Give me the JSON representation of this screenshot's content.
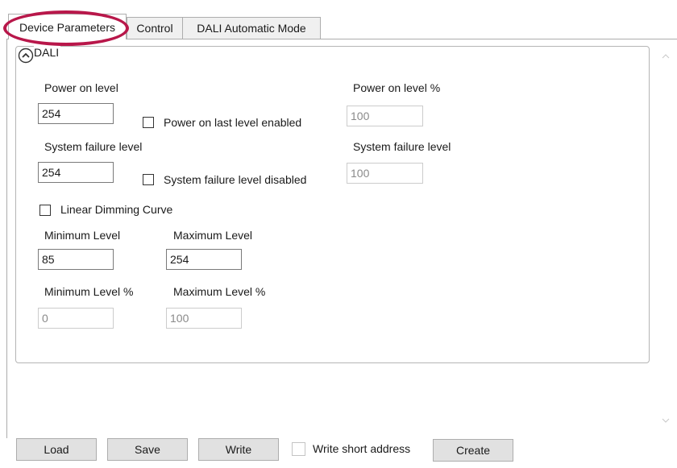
{
  "tabs": [
    {
      "label": "Device Parameters",
      "active": true
    },
    {
      "label": "Control",
      "active": false
    },
    {
      "label": "DALI Automatic Mode",
      "active": false
    }
  ],
  "group": {
    "title": "DALI",
    "collapse_icon": "chevron-up-circle-icon"
  },
  "fields": {
    "power_on_level": {
      "label": "Power on level",
      "value": "254"
    },
    "power_on_level_pct": {
      "label": "Power on level %",
      "value": "100"
    },
    "power_on_last_level_enabled": {
      "label": "Power on last level enabled",
      "checked": false
    },
    "system_failure_level": {
      "label": "System failure level",
      "value": "254"
    },
    "system_failure_level_pct": {
      "label": "System failure level",
      "value": "100"
    },
    "system_failure_level_disabled": {
      "label": "System failure level disabled",
      "checked": false
    },
    "linear_dimming_curve": {
      "label": "Linear Dimming Curve",
      "checked": false
    },
    "minimum_level": {
      "label": "Minimum Level",
      "value": "85"
    },
    "maximum_level": {
      "label": "Maximum Level",
      "value": "254"
    },
    "minimum_level_pct": {
      "label": "Minimum Level %",
      "value": "0"
    },
    "maximum_level_pct": {
      "label": "Maximum Level %",
      "value": "100"
    }
  },
  "buttons": {
    "load": "Load",
    "save": "Save",
    "write": "Write",
    "write_short_address": "Write short address",
    "create": "Create"
  },
  "colors": {
    "highlight": "#b8174a",
    "border": "#adadad",
    "button_bg": "#e1e1e1"
  }
}
